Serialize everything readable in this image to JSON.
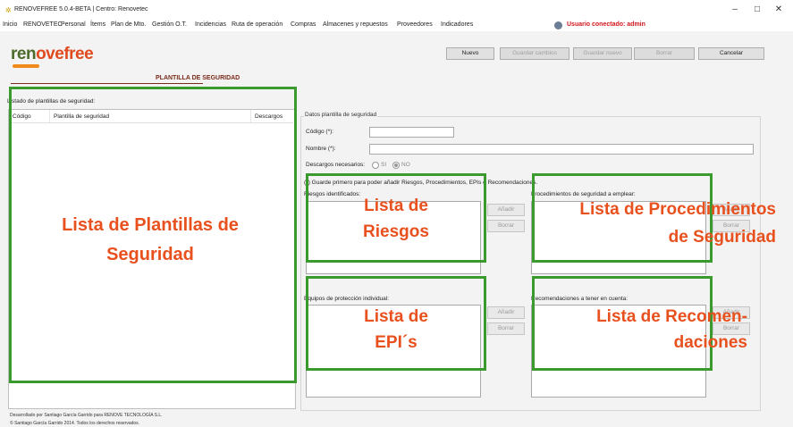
{
  "window": {
    "title": "RENOVEFREE 5.0.4-BETA | Centro: Renovetec",
    "minimize_glyph": "–",
    "maximize_glyph": "□",
    "close_glyph": "✕"
  },
  "menu": {
    "items": [
      "Inicio",
      "RENOVETEC",
      "Personal",
      "Ítems",
      "Plan de Mto.",
      "Gestión O.T.",
      "Incidencias",
      "Ruta de operación",
      "Compras",
      "Almacenes y repuestos",
      "Proveedores",
      "Indicadores"
    ],
    "user_label": "Usuario conectado: admin"
  },
  "logo": {
    "part1": "ren",
    "part2": "ovefree"
  },
  "module_title": "PLANTILLA DE SEGURIDAD",
  "toolbar": {
    "nuevo": "Nuevo",
    "guardar_cambios": "Guardar cambios",
    "guardar_nuevo": "Guardar nuevo",
    "borrar": "Borrar",
    "cancelar": "Cancelar"
  },
  "list": {
    "label": "Listado de plantillas de seguridad:",
    "columns": [
      "Código",
      "Plantilla de seguridad",
      "Descargos"
    ]
  },
  "form": {
    "group_title": "Datos plantilla de seguridad",
    "codigo_label": "Código (*):",
    "codigo_value": "",
    "nombre_label": "Nombre (*):",
    "nombre_value": "",
    "descargos_label": "Descargos necesarios:",
    "si_label": "SI",
    "no_label": "NO",
    "note": "(*) Guarde primero para poder añadir Riesgos, Procedimientos, EPIs o Recomendaciones.",
    "riesgos_label": "Riesgos identificados:",
    "procedimientos_label": "Procedimientos de seguridad a emplear:",
    "epis_label": "Equipos de protección individual:",
    "recomendaciones_label": "Recomendaciones a tener en cuenta:",
    "anadir": "Añadir",
    "borrar": "Borrar"
  },
  "annotations": {
    "plantillas": "Lista de Plantillas de\nSeguridad",
    "riesgos": "Lista de\nRiesgos",
    "procedimientos": "Lista de Procedimientos\nde Seguridad",
    "epis": "Lista de\nEPI´s",
    "recomendaciones": "Lista de Recomen-\ndaciones"
  },
  "footer": {
    "line1": "Desarrollado por Santiago García Garrido para RENOVE TECNOLOGÍA S.L.",
    "line2": "© Santiago García Garrido 2014. Todos los derechos reservados."
  },
  "colors": {
    "annotation_text": "#e8501e",
    "annotation_box": "#3a9a2e",
    "user_text": "#d1151b"
  }
}
